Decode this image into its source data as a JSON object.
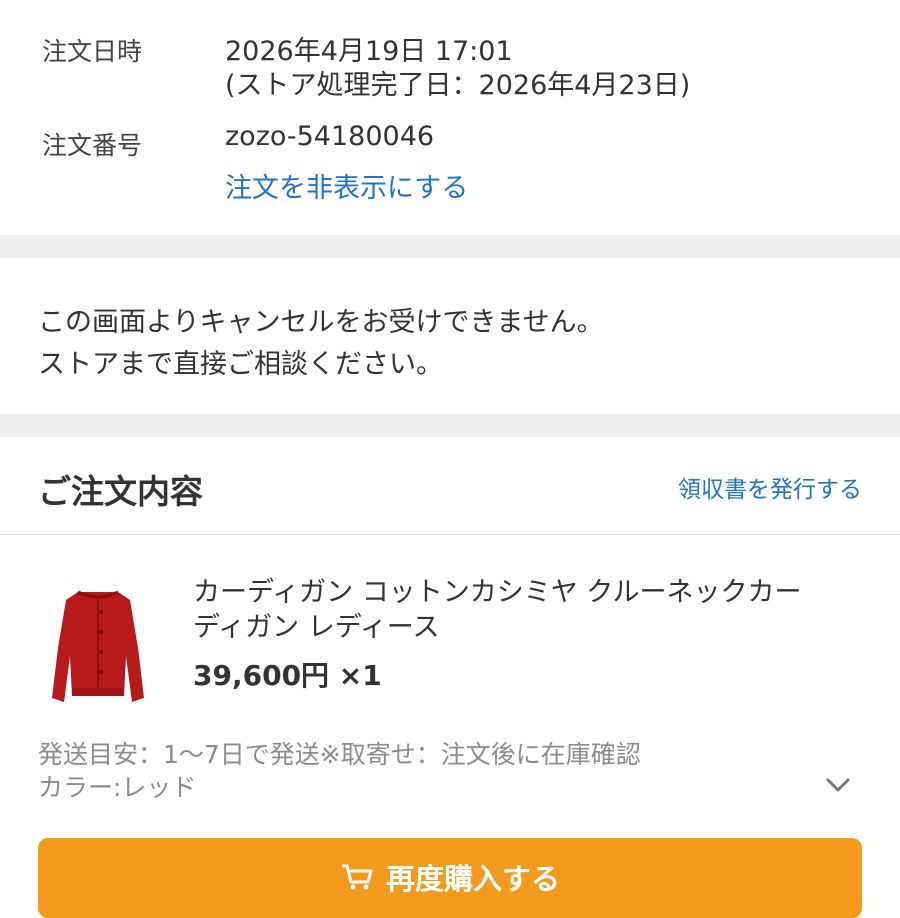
{
  "order_info": {
    "date_label": "注文日時",
    "date_value": "2026年4月19日 17:01",
    "store_done": "(ストア処理完了日：2026年4月23日)",
    "number_label": "注文番号",
    "number_value": "zozo-54180046",
    "hide_link": "注文を非表示にする"
  },
  "notice": {
    "line1": "この画面よりキャンセルをお受けできません。",
    "line2": "ストアまで直接ご相談ください。"
  },
  "order_details": {
    "title": "ご注文内容",
    "receipt_link": "領収書を発行する"
  },
  "product": {
    "name_line1": "カーディガン コットンカシミヤ クルーネックカー",
    "name_line2": "ディガン レディース",
    "price": "39,600円 ×1",
    "shipping": "発送目安：1〜7日で発送※取寄せ：注文後に在庫確認",
    "color": "カラー:レッド",
    "image_icon": "red-cardigan-image"
  },
  "actions": {
    "rebuy_label": "再度購入する",
    "rebuy_icon": "cart-icon"
  },
  "colors": {
    "link": "#1f73c9",
    "button": "#f39a1c",
    "product": "#b8191a"
  }
}
